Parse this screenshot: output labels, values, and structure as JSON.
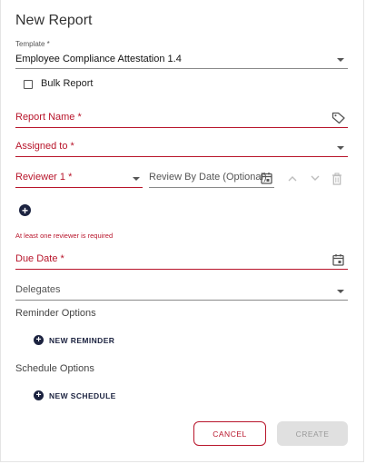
{
  "dialog": {
    "title": "New Report"
  },
  "template_field": {
    "label": "Template *",
    "value": "Employee Compliance Attestation 1.4"
  },
  "bulk_report": {
    "label": "Bulk Report",
    "checked": false
  },
  "report_name": {
    "label": "Report Name *",
    "icon": "tag-icon"
  },
  "assigned_to": {
    "label": "Assigned to *"
  },
  "reviewer": {
    "label": "Reviewer 1 *",
    "review_by_date_label": "Review By Date (Optional)",
    "error": "At least one reviewer is required"
  },
  "due_date": {
    "label": "Due Date *"
  },
  "delegates": {
    "label": "Delegates"
  },
  "reminder_options": {
    "label": "Reminder Options",
    "add_label": "NEW REMINDER"
  },
  "schedule_options": {
    "label": "Schedule Options",
    "add_label": "NEW SCHEDULE"
  },
  "actions": {
    "cancel_label": "CANCEL",
    "create_label": "CREATE"
  },
  "colors": {
    "accent_red": "#b8152b",
    "navy": "#1c2340",
    "disabled_bg": "#e0e0e0"
  }
}
